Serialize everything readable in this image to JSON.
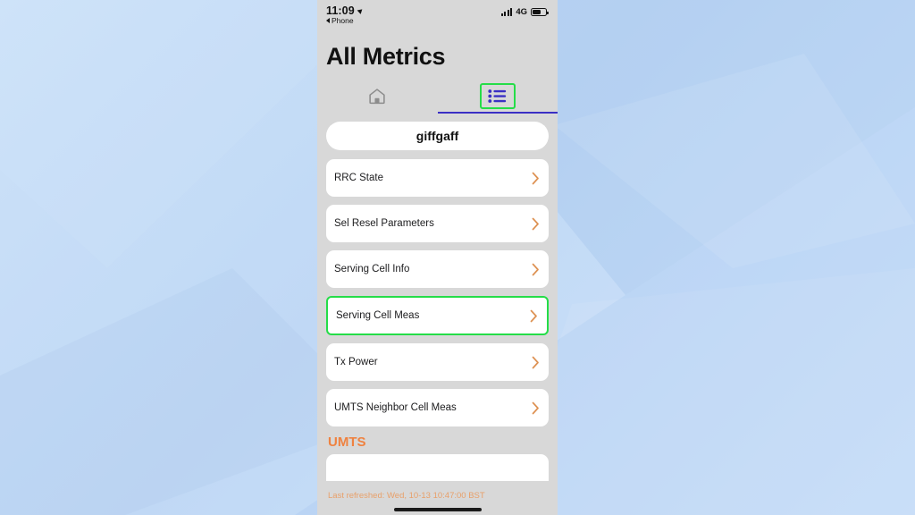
{
  "status_bar": {
    "time": "11:09",
    "location_icon": "location-arrow-icon",
    "back_label": "Phone",
    "signal_icon": "signal-bars-icon",
    "network": "4G",
    "battery_icon": "battery-icon"
  },
  "header": {
    "title": "All Metrics"
  },
  "tabs": [
    {
      "name": "home",
      "icon": "home-icon",
      "selected": false
    },
    {
      "name": "list",
      "icon": "list-icon",
      "selected": true
    }
  ],
  "carrier": {
    "name": "giffgaff"
  },
  "metrics_rows": [
    {
      "label": "RRC State",
      "chevron": "chevron-right-icon",
      "highlighted": false
    },
    {
      "label": "Sel Resel Parameters",
      "chevron": "chevron-right-icon",
      "highlighted": false
    },
    {
      "label": "Serving Cell Info",
      "chevron": "chevron-right-icon",
      "highlighted": false
    },
    {
      "label": "Serving Cell Meas",
      "chevron": "chevron-right-icon",
      "highlighted": true
    },
    {
      "label": "Tx Power",
      "chevron": "chevron-right-icon",
      "highlighted": false
    },
    {
      "label": "UMTS Neighbor Cell Meas",
      "chevron": "chevron-right-icon",
      "highlighted": false
    }
  ],
  "section": {
    "umts_title": "UMTS"
  },
  "footer": {
    "last_refreshed": "Last refreshed: Wed, 10-13 10:47:00 BST"
  },
  "colors": {
    "accent_orange": "#ef8240",
    "highlight_green": "#25dd48",
    "tab_indigo": "#3a2fc4",
    "chevron_orange": "#dd9152",
    "phone_bg": "#d8d8d8"
  }
}
